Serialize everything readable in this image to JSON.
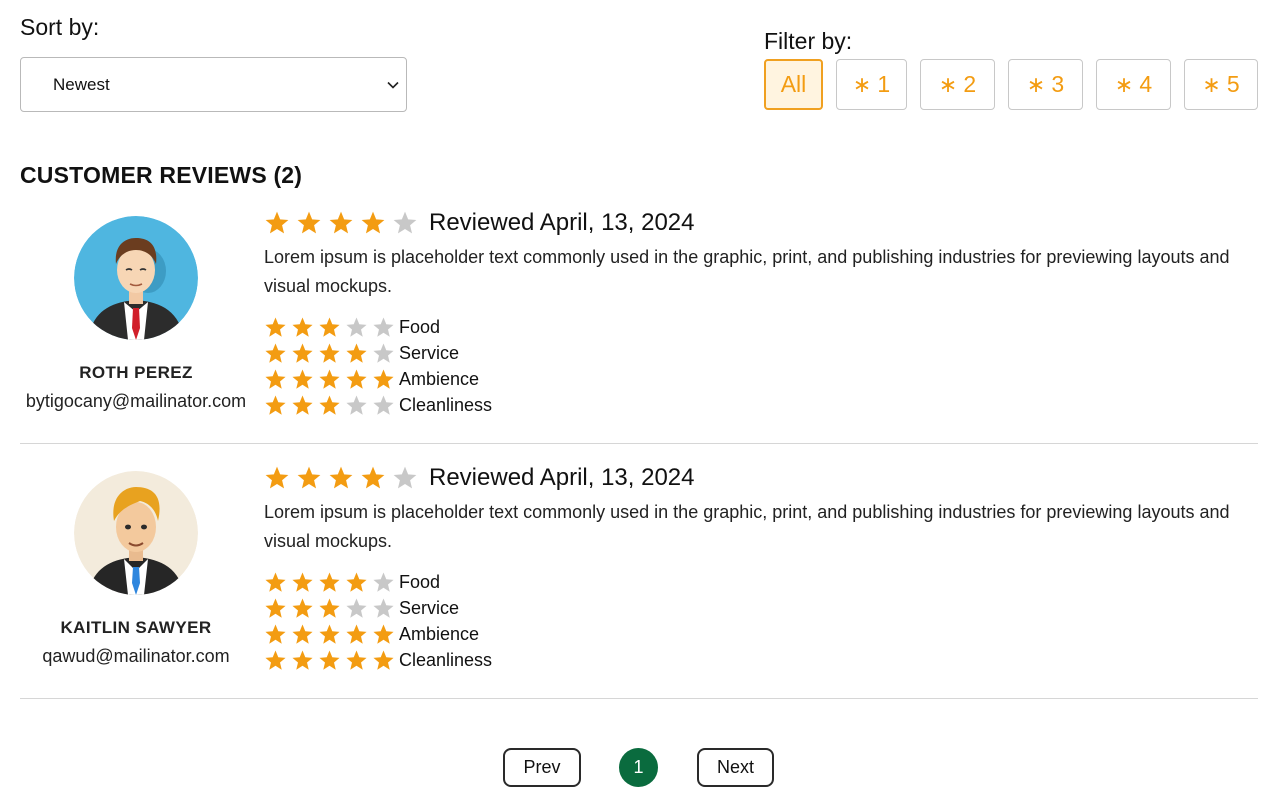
{
  "sort": {
    "label": "Sort by:",
    "value": "Newest"
  },
  "filter": {
    "label": "Filter by:",
    "options": [
      {
        "label": "All",
        "active": true
      },
      {
        "star_glyph": "∗",
        "label": "1"
      },
      {
        "star_glyph": "∗",
        "label": "2"
      },
      {
        "star_glyph": "∗",
        "label": "3"
      },
      {
        "star_glyph": "∗",
        "label": "4"
      },
      {
        "star_glyph": "∗",
        "label": "5"
      }
    ]
  },
  "reviews_heading": "CUSTOMER REVIEWS (2)",
  "colors": {
    "star_filled": "#f39c12",
    "star_empty": "#c8c8c8",
    "page_active": "#0a6b3e",
    "accent": "#f39c12"
  },
  "reviews": [
    {
      "name": "ROTH PEREZ",
      "email": "bytigocany@mailinator.com",
      "avatar_icon": "businessman-avatar-icon",
      "rating": 4,
      "date": "Reviewed April, 13, 2024",
      "text": "Lorem ipsum is placeholder text commonly used in the graphic, print, and publishing industries for previewing layouts and visual mockups.",
      "categories": [
        {
          "label": "Food",
          "rating": 3
        },
        {
          "label": "Service",
          "rating": 4
        },
        {
          "label": "Ambience",
          "rating": 5
        },
        {
          "label": "Cleanliness",
          "rating": 3
        }
      ]
    },
    {
      "name": "KAITLIN SAWYER",
      "email": "qawud@mailinator.com",
      "avatar_icon": "blond-man-avatar-icon",
      "rating": 4,
      "date": "Reviewed April, 13, 2024",
      "text": "Lorem ipsum is placeholder text commonly used in the graphic, print, and publishing industries for previewing layouts and visual mockups.",
      "categories": [
        {
          "label": "Food",
          "rating": 4
        },
        {
          "label": "Service",
          "rating": 3
        },
        {
          "label": "Ambience",
          "rating": 5
        },
        {
          "label": "Cleanliness",
          "rating": 5
        }
      ]
    }
  ],
  "pagination": {
    "prev_label": "Prev",
    "current_page": "1",
    "next_label": "Next"
  }
}
